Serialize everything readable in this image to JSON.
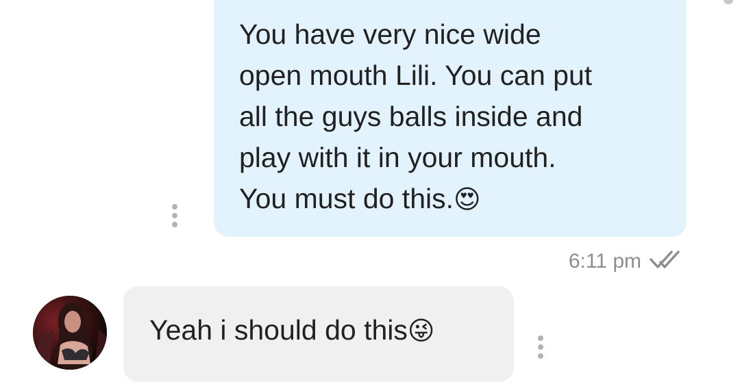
{
  "messages": [
    {
      "direction": "outgoing",
      "lines": [
        "You have very nice wide",
        "open mouth Lili. You can put",
        "all the guys balls inside and",
        "play with it in your mouth."
      ],
      "last_line": "You must do this.",
      "emoji": "😍",
      "emoji_name": "heart-eyes-emoji",
      "time": "6:11 pm",
      "status": "read",
      "status_icon": "double-check-icon"
    },
    {
      "direction": "incoming",
      "text": "Yeah i should do this",
      "emoji": "😜",
      "emoji_name": "winking-tongue-emoji"
    }
  ],
  "colors": {
    "outgoing_bubble": "#e3f3fd",
    "incoming_bubble": "#f0f0f1",
    "timestamp": "#8a8f94",
    "more_dots": "#b3b3b3"
  }
}
